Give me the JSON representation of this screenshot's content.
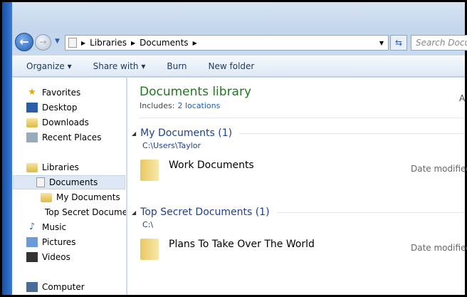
{
  "address": {
    "crumbs": [
      "Libraries",
      "Documents"
    ],
    "search_placeholder": "Search Documents"
  },
  "toolbar": {
    "organize": "Organize ▾",
    "share": "Share with ▾",
    "burn": "Burn",
    "new_folder": "New folder"
  },
  "sidebar": {
    "favorites": "Favorites",
    "desktop": "Desktop",
    "downloads": "Downloads",
    "recent": "Recent Places",
    "libraries": "Libraries",
    "documents": "Documents",
    "my_documents": "My Documents",
    "top_secret": "Top Secret Documents",
    "music": "Music",
    "pictures": "Pictures",
    "videos": "Videos",
    "computer": "Computer"
  },
  "main": {
    "title": "Documents library",
    "includes": "Includes:",
    "locations": "2 locations",
    "arrange": "A",
    "groups": [
      {
        "name": "My Documents (1)",
        "path": "C:\\Users\\Taylor",
        "item": "Work Documents",
        "date": "Date modified"
      },
      {
        "name": "Top Secret Documents (1)",
        "path": "C:\\",
        "item": "Plans To Take Over The World",
        "date": "Date modified"
      }
    ]
  }
}
